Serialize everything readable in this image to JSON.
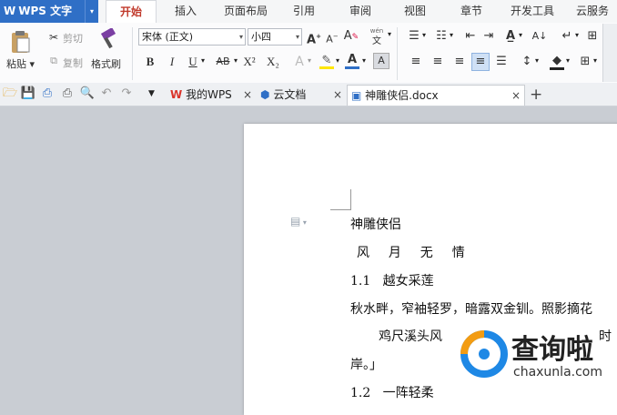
{
  "app": {
    "name": "WPS 文字",
    "logo": "W",
    "dropdown": "▾"
  },
  "menu": {
    "tabs": [
      "开始",
      "插入",
      "页面布局",
      "引用",
      "审阅",
      "视图",
      "章节",
      "开发工具",
      "云服务"
    ],
    "active": "开始"
  },
  "ribbon": {
    "paste_label": "粘贴",
    "cut_label": "剪切",
    "copy_label": "复制",
    "format_painter_label": "格式刷",
    "font_name": "宋体 (正文)",
    "font_size": "小四",
    "bold": "B",
    "italic": "I",
    "underline": "U",
    "strikethrough": "AB",
    "superscript": "X²",
    "subscript": "X₂",
    "pinyin": "文"
  },
  "tabs": [
    {
      "label": "我的WPS",
      "icon": "wps-logo-icon"
    },
    {
      "label": "云文档",
      "icon": "cloud-doc-icon"
    },
    {
      "label": "神雕侠侣.docx",
      "icon": "word-doc-icon",
      "active": true
    }
  ],
  "document": {
    "title": "神雕侠侣",
    "subtitle": "风  月  无  情",
    "h1_num": "1.1",
    "h1": "越女采莲",
    "p1": "秋水畔，窄袖轻罗，暗露双金钏。照影摘花",
    "p2": "鸡尺溪头风",
    "p2_tail": "时",
    "p3": "岸。」",
    "h2_num": "1.2",
    "h2": "一阵轻柔"
  },
  "watermark": {
    "brand": "查询啦",
    "url": "chaxunla.com"
  },
  "colors": {
    "accent": "#2f6fc6",
    "active_tab": "#c0392b",
    "wm_blue": "#1e88e5",
    "wm_orange": "#f39c12"
  }
}
